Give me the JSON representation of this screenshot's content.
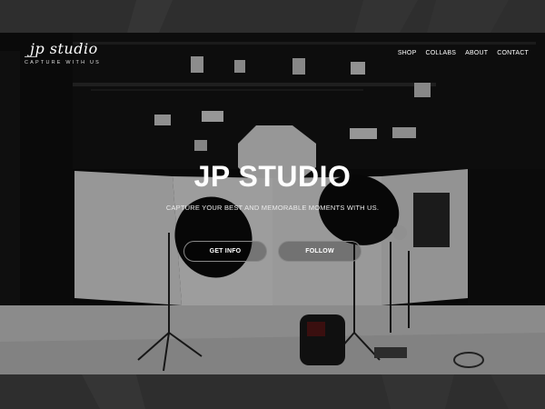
{
  "brand": {
    "script_name": "jp studio",
    "tagline": "CAPTURE WITH US"
  },
  "nav": {
    "items": [
      {
        "label": "SHOP"
      },
      {
        "label": "COLLABS"
      },
      {
        "label": "ABOUT"
      },
      {
        "label": "CONTACT"
      }
    ]
  },
  "hero": {
    "title": "JP STUDIO",
    "subtitle": "CAPTURE YOUR BEST AND MEMORABLE MOMENTS WITH US.",
    "primary_button": "GET INFO",
    "secondary_button": "FOLLOW"
  },
  "colors": {
    "background": "#2a2a2a",
    "band": "#2e2e2e",
    "text": "#ffffff",
    "button_border": "#888888"
  },
  "icons": [
    "studio-photo-background",
    "decorative-band-pattern"
  ]
}
